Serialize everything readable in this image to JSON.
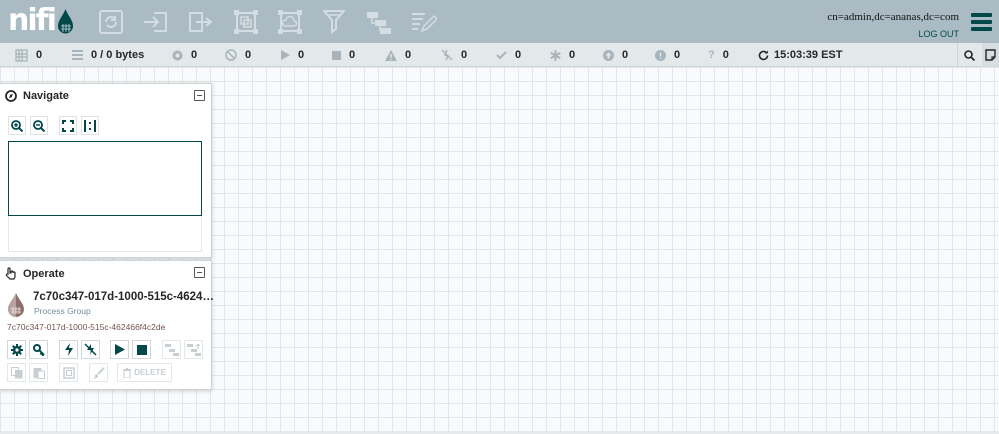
{
  "header": {
    "logo_text": "nifi",
    "user": "cn=admin,dc=ananas,dc=com",
    "logout": "LOG OUT",
    "tools": [
      "processor-icon",
      "input-port-icon",
      "output-port-icon",
      "process-group-icon",
      "remote-process-group-icon",
      "funnel-icon",
      "template-icon",
      "label-icon"
    ]
  },
  "status": {
    "threads": "0",
    "queued": "0 / 0 bytes",
    "transmitting": "0",
    "not_transmitting": "0",
    "running": "0",
    "stopped": "0",
    "invalid": "0",
    "disabled": "0",
    "up_to_date": "0",
    "locally_modified": "0",
    "stale": "0",
    "locally_modified_stale": "0",
    "sync_failure": "0",
    "refresh_time": "15:03:39 EST"
  },
  "navigate": {
    "title": "Navigate"
  },
  "operate": {
    "title": "Operate",
    "name": "7c70c347-017d-1000-515c-4624…",
    "type": "Process Group",
    "id": "7c70c347-017d-1000-515c-462466f4c2de",
    "delete_label": "DELETE"
  },
  "colors": {
    "header_bg": "#aabbc3",
    "accent": "#004849",
    "status_bg": "#e3e8eb",
    "id_color": "#775351"
  }
}
